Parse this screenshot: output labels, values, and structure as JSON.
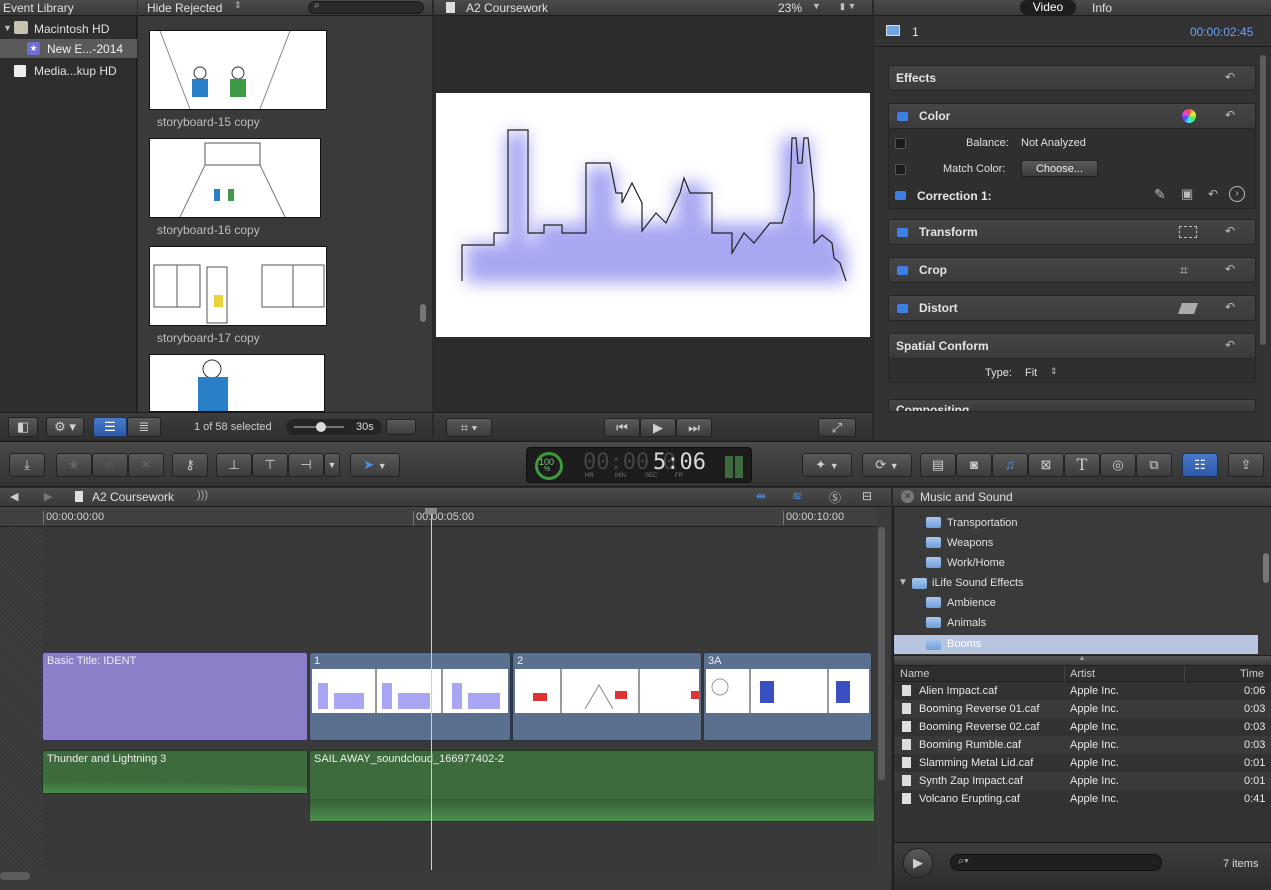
{
  "event_library": {
    "header": "Event Library",
    "items": [
      "Macintosh HD",
      "New E...-2014",
      "Media...kup HD"
    ]
  },
  "browser": {
    "filter_label": "Hide Rejected",
    "clips": [
      {
        "label": "storyboard-15 copy"
      },
      {
        "label": "storyboard-16 copy"
      },
      {
        "label": "storyboard-17 copy"
      }
    ],
    "selection_status": "1 of 58 selected",
    "duration": "30s"
  },
  "viewer": {
    "title": "A2 Coursework",
    "zoom": "23%"
  },
  "inspector": {
    "tabs": [
      "Video",
      "Info"
    ],
    "active_tab": "Video",
    "clip_number": "1",
    "timecode": "00:00:02:45",
    "sections": {
      "effects": "Effects",
      "color": "Color",
      "balance_label": "Balance:",
      "balance_value": "Not Analyzed",
      "match_color_label": "Match Color:",
      "match_color_button": "Choose...",
      "correction": "Correction 1:",
      "transform": "Transform",
      "crop": "Crop",
      "distort": "Distort",
      "spatial_conform": "Spatial Conform",
      "type_label": "Type:",
      "type_value": "Fit",
      "compositing": "Compositing"
    }
  },
  "dashboard": {
    "percent": "100",
    "percent_sign": "%",
    "timecode_dim": "00:00:0",
    "timecode_bright": "5:06",
    "units": [
      "HR",
      "MIN",
      "SEC",
      "FR"
    ]
  },
  "timeline": {
    "project_name": "A2 Coursework",
    "ruler": [
      "00:00:00:00",
      "00:00:05:00",
      "00:00:10:00"
    ],
    "clips": {
      "title_clip": "Basic Title: IDENT",
      "clip1": "1",
      "clip2": "2",
      "clip3": "3A",
      "audio1": "Thunder and Lightning 3",
      "audio2": "SAIL AWAY_soundcloud_166977402-2"
    }
  },
  "music_browser": {
    "title": "Music and Sound",
    "folders": [
      "Transportation",
      "Weapons",
      "Work/Home",
      "iLife Sound Effects",
      "Ambience",
      "Animals",
      "Booms"
    ],
    "selected_folder": "Booms",
    "columns": [
      "Name",
      "Artist",
      "Time"
    ],
    "rows": [
      {
        "name": "Alien Impact.caf",
        "artist": "Apple Inc.",
        "time": "0:06"
      },
      {
        "name": "Booming Reverse 01.caf",
        "artist": "Apple Inc.",
        "time": "0:03"
      },
      {
        "name": "Booming Reverse 02.caf",
        "artist": "Apple Inc.",
        "time": "0:03"
      },
      {
        "name": "Booming Rumble.caf",
        "artist": "Apple Inc.",
        "time": "0:03"
      },
      {
        "name": "Slamming Metal Lid.caf",
        "artist": "Apple Inc.",
        "time": "0:01"
      },
      {
        "name": "Synth Zap Impact.caf",
        "artist": "Apple Inc.",
        "time": "0:01"
      },
      {
        "name": "Volcano Erupting.caf",
        "artist": "Apple Inc.",
        "time": "0:41"
      }
    ],
    "item_count": "7 items"
  },
  "colors": {
    "accent_blue": "#3e7fe6",
    "title_clip": "#8b7fc9",
    "video_clip": "#5b6f8f",
    "audio_clip": "#3e6b3e",
    "selection": "#b7c5e0"
  }
}
